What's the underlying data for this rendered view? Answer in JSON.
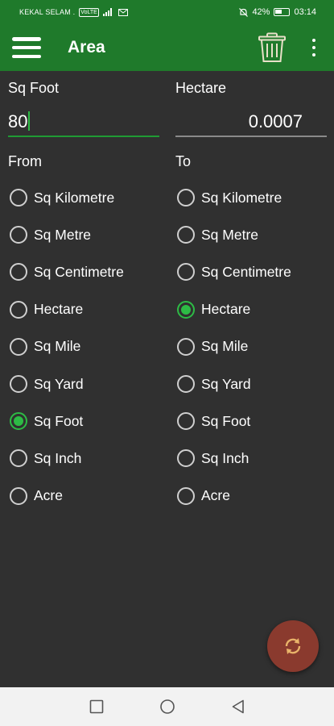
{
  "status_bar": {
    "carrier": "KEKAL SELAM .",
    "network_badge": "VoLTE",
    "battery": "42%",
    "time": "03:14",
    "icons": [
      "signal-icon",
      "wifi-icon",
      "mail-icon",
      "mute-alarm-icon",
      "battery-icon"
    ]
  },
  "app_bar": {
    "title": "Area",
    "icons": [
      "menu-icon",
      "trash-icon",
      "more-vert-icon"
    ]
  },
  "input": {
    "label": "Sq Foot",
    "value": "80"
  },
  "output": {
    "label": "Hectare",
    "value": "0.0007"
  },
  "from": {
    "label": "From",
    "selected": "Sq Foot",
    "options": [
      "Sq Kilometre",
      "Sq Metre",
      "Sq Centimetre",
      "Hectare",
      "Sq Mile",
      "Sq Yard",
      "Sq Foot",
      "Sq Inch",
      "Acre"
    ]
  },
  "to": {
    "label": "To",
    "selected": "Hectare",
    "options": [
      "Sq Kilometre",
      "Sq Metre",
      "Sq Centimetre",
      "Hectare",
      "Sq Mile",
      "Sq Yard",
      "Sq Foot",
      "Sq Inch",
      "Acre"
    ]
  },
  "fab": {
    "icon": "swap-refresh-icon"
  },
  "nav_bar": {
    "icons": [
      "recents-square-icon",
      "home-circle-icon",
      "back-triangle-icon"
    ]
  },
  "colors": {
    "primary": "#1f7a2b",
    "accent": "#2dbb45",
    "background": "#303030",
    "fab": "#8a3a2e"
  }
}
